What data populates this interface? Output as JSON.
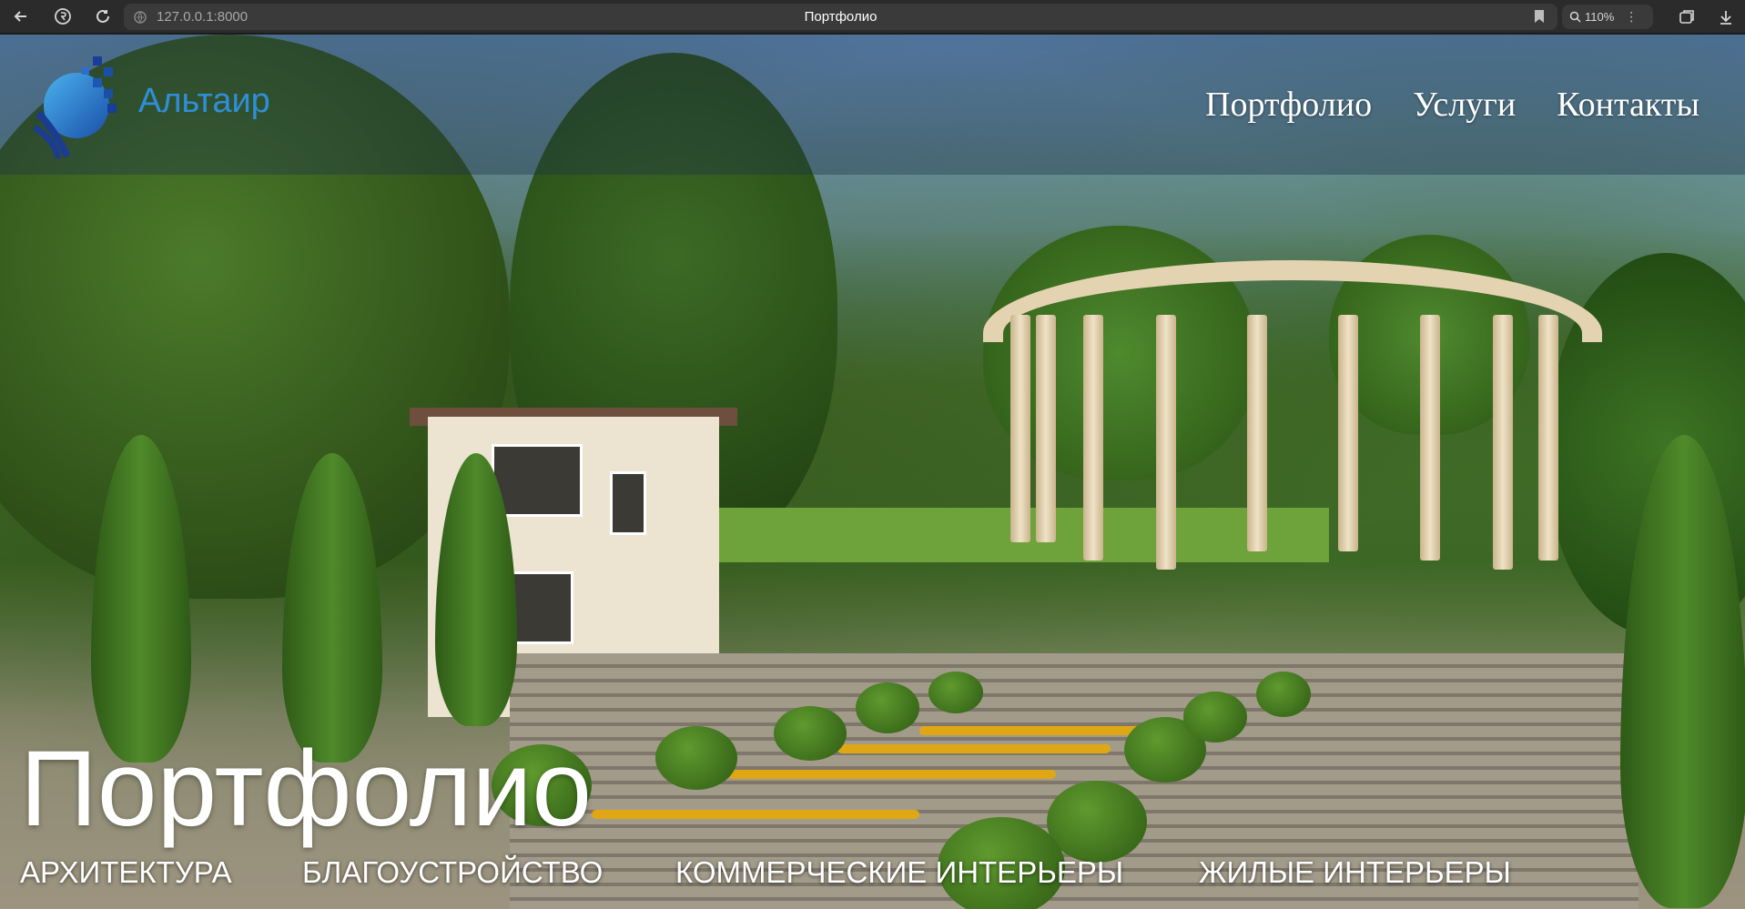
{
  "browser": {
    "url": "127.0.0.1:8000",
    "tab_title": "Портфолио",
    "zoom": "110%"
  },
  "site": {
    "brand": "Альтаир",
    "nav": [
      "Портфолио",
      "Услуги",
      "Контакты"
    ]
  },
  "hero": {
    "title": "Портфолио",
    "categories": [
      "АРХИТЕКТУРА",
      "БЛАГОУСТРОЙСТВО",
      "КОММЕРЧЕСКИЕ ИНТЕРЬЕРЫ",
      "ЖИЛЫЕ ИНТЕРЬЕРЫ"
    ]
  },
  "colors": {
    "brand_blue": "#2f8fd6",
    "chrome_bg": "#2b2b2b"
  },
  "icons": [
    "back-arrow-icon",
    "yandex-icon",
    "reload-icon",
    "site-info-icon",
    "bookmark-icon",
    "zoom-icon",
    "more-icon",
    "extensions-icon",
    "download-icon"
  ]
}
